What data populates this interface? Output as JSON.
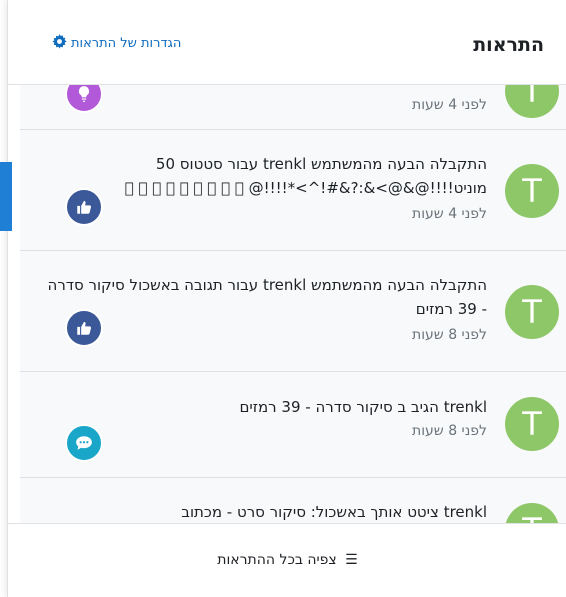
{
  "header": {
    "title": "התראות",
    "settings_label": "הגדרות של התראות",
    "settings_icon": "gear-icon"
  },
  "notifications": [
    {
      "avatar_letter": "T",
      "text": "",
      "time": "לפני 4 שעות",
      "badge_icon": "lightbulb-icon",
      "badge_color": "#b159d8"
    },
    {
      "avatar_letter": "T",
      "text": "התקבלה הבעה מהמשתמש trenkl עבור סטטוס 50 מוניט!!!!@&@>‎<‎^!#&‎?:&‎*!!!!@ ⃞ ⃞ ⃞ ⃞ ⃞ ⃞ ⃞ ⃞ ⃞",
      "time": "לפני 4 שעות",
      "badge_icon": "thumbs-up-icon",
      "badge_color": "#3b5998"
    },
    {
      "avatar_letter": "T",
      "text": "התקבלה הבעה מהמשתמש trenkl עבור תגובה באשכול סיקור סדרה - 39 רמזים",
      "time": "לפני 8 שעות",
      "badge_icon": "thumbs-up-icon",
      "badge_color": "#3b5998"
    },
    {
      "avatar_letter": "T",
      "text": "trenkl הגיב ב סיקור סדרה - 39 רמזים",
      "time": "לפני 8 שעות",
      "badge_icon": "comment-icon",
      "badge_color": "#1aa6c9"
    },
    {
      "avatar_letter": "T",
      "text": "trenkl ציטט אותך באשכול: סיקור סרט - מכתוב",
      "time": "",
      "badge_icon": "",
      "badge_color": ""
    }
  ],
  "footer": {
    "view_all_label": "צפיה בכל ההתראות",
    "view_all_icon": "list-icon"
  },
  "colors": {
    "link": "#0f6cbf",
    "avatar": "#8dc767",
    "scroll_indicator": "#1f7fd4"
  }
}
